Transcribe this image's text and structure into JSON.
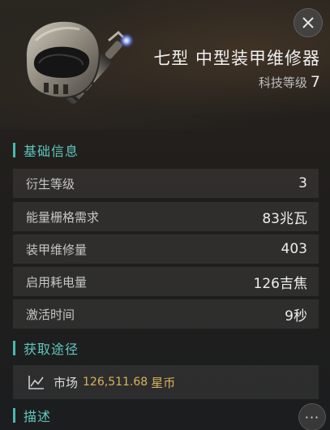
{
  "item": {
    "title": "七型 中型装甲维修器",
    "tech_label": "科技等级",
    "tech_level": "7",
    "art_icon": "armor-repairer-helmet-torch-icon"
  },
  "close_icon": "close-icon",
  "basic_info": {
    "header": "基础信息",
    "rows": [
      {
        "label": "衍生等级",
        "value": "3"
      },
      {
        "label": "能量栅格需求",
        "value": "83兆瓦"
      },
      {
        "label": "装甲维修量",
        "value": "403"
      },
      {
        "label": "启用耗电量",
        "value": "126吉焦"
      },
      {
        "label": "激活时间",
        "value": "9秒"
      }
    ]
  },
  "acquisition": {
    "header": "获取途径",
    "market_icon": "market-trend-icon",
    "market_label": "市场",
    "market_price": "126,511.68",
    "market_currency": "星币"
  },
  "description": {
    "header": "描述",
    "more_icon": "more-options-icon",
    "more_glyph": "···"
  },
  "colors": {
    "accent": "#5ec8be",
    "price": "#d7b45a"
  }
}
